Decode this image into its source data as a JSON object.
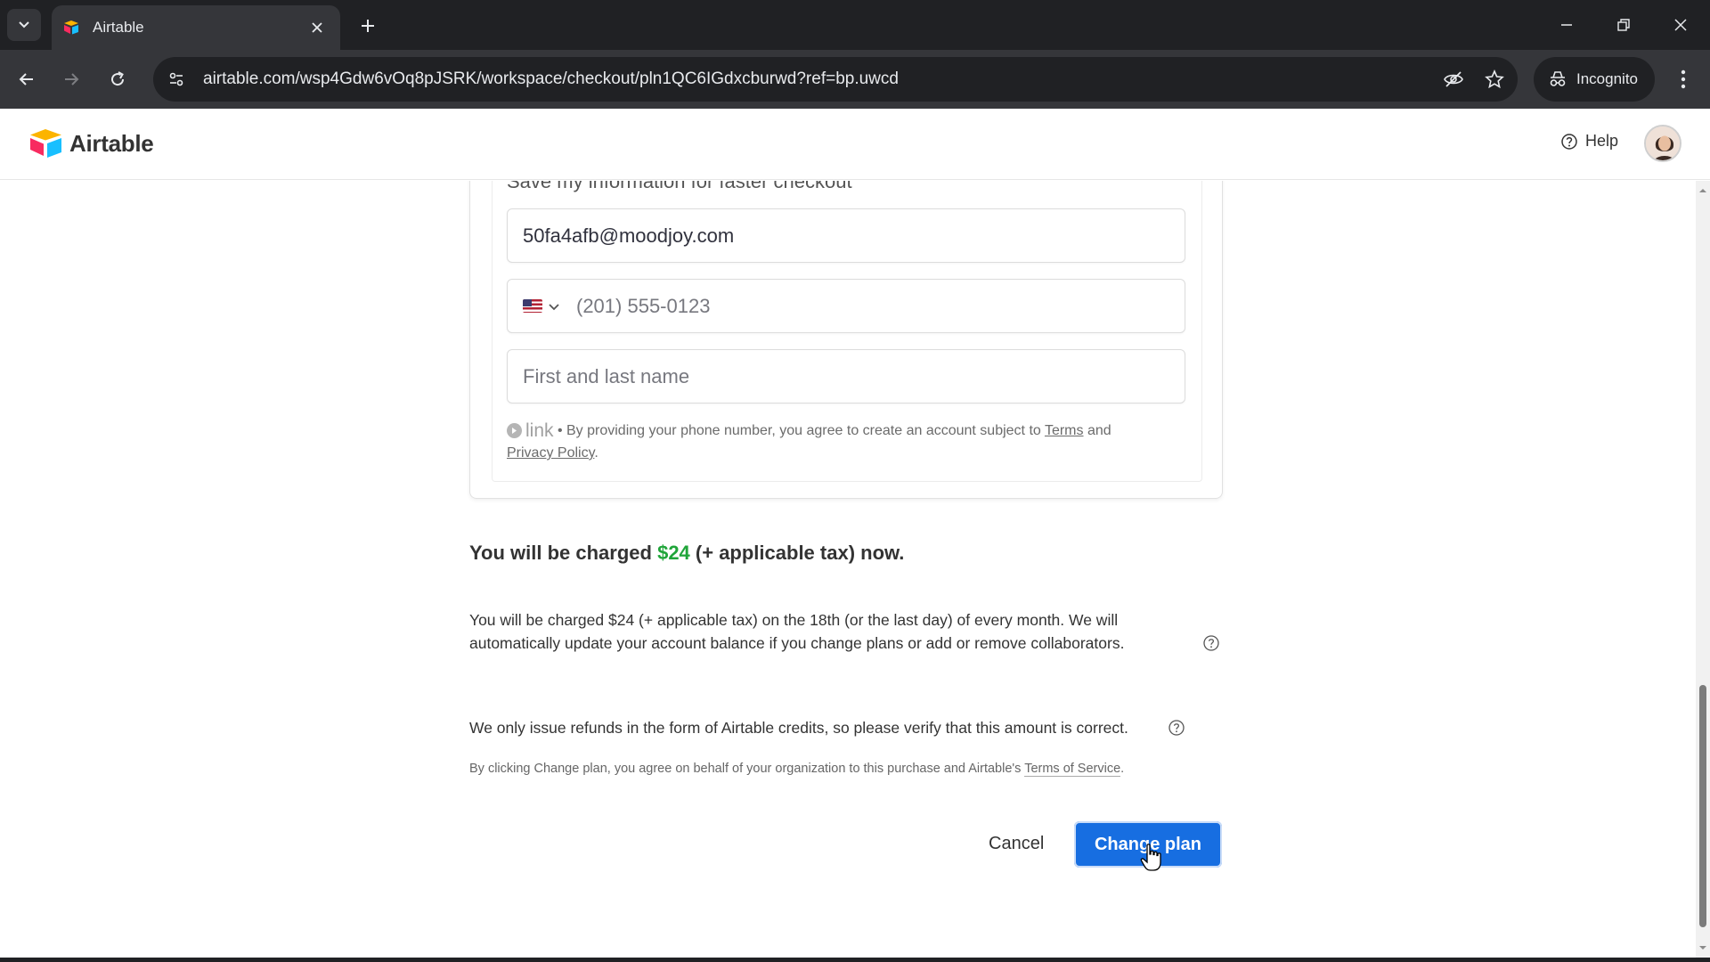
{
  "browser": {
    "tab_title": "Airtable",
    "url": "airtable.com/wsp4Gdw6vOq8pJSRK/workspace/checkout/pln1QC6IGdxcburwd?ref=bp.uwcd",
    "incognito_label": "Incognito"
  },
  "header": {
    "logo_text": "Airtable",
    "help_label": "Help"
  },
  "form": {
    "save_info_label": "Save my information for faster checkout",
    "email_value": "50fa4afb@moodjoy.com",
    "phone_placeholder": "(201) 555-0123",
    "name_placeholder": "First and last name",
    "link_brand": "link",
    "link_note_prefix": " • By providing your phone number, you agree to create an account subject to ",
    "terms_link": "Terms",
    "and_text": " and ",
    "privacy_link": "Privacy Policy",
    "period": "."
  },
  "billing": {
    "headline_prefix": "You will be charged ",
    "headline_amount": "$24",
    "headline_suffix": " (+ applicable tax) now.",
    "detail": "You will be charged $24 (+ applicable tax) on the 18th (or the last day) of every month. We will automatically update your account balance if you change plans or add or remove collaborators.",
    "refund_note": "We only issue refunds in the form of Airtable credits, so please verify that this amount is correct.",
    "terms_prefix": "By clicking Change plan, you agree on behalf of your organization to this purchase and Airtable's ",
    "terms_link": "Terms of Service",
    "terms_suffix": "."
  },
  "actions": {
    "cancel_label": "Cancel",
    "change_plan_label": "Change plan"
  },
  "colors": {
    "primary_button": "#176ee1",
    "price_green": "#20a53a"
  }
}
